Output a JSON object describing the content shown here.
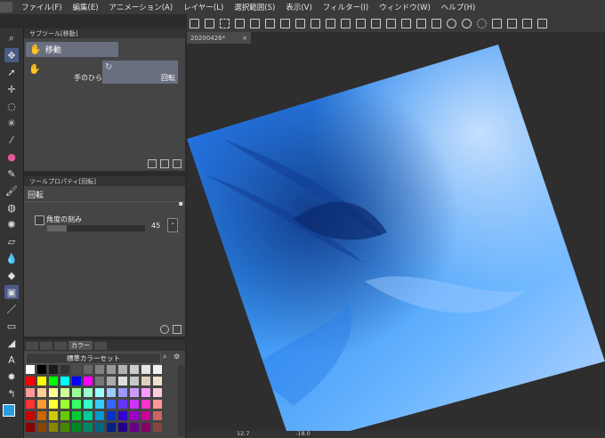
{
  "menu": [
    "ファイル(F)",
    "編集(E)",
    "アニメーション(A)",
    "レイヤー(L)",
    "選択範囲(S)",
    "表示(V)",
    "フィルター(I)",
    "ウィンドウ(W)",
    "ヘルプ(H)"
  ],
  "subtool": {
    "header": "サブツール[移動]",
    "group_label": "移動",
    "item_label": "手のひら",
    "rotate_label": "回転"
  },
  "tool_property": {
    "header": "ツールプロパティ[回転]",
    "title": "回転",
    "angle_label": "角度の刻み",
    "angle_value": "45"
  },
  "color_set": {
    "tab_label": "カラー",
    "set_name": "標準カラーセット"
  },
  "document": {
    "tab_label": "20200426*"
  },
  "status": {
    "zoom": "12.7",
    "angle": "-18.0"
  },
  "colors": {
    "accent": "#4a5c86",
    "main_color": "#2a9bdc"
  },
  "palette": {
    "row1": [
      "#ffffff",
      "#000000",
      "#1a1a1a",
      "#333333",
      "#4d4d4d",
      "#666666",
      "#808080",
      "#999999",
      "#b3b3b3",
      "#cccccc",
      "#e6e6e6",
      "#f2f2f2"
    ],
    "row2": [
      "#ff0000",
      "#ffff00",
      "#00ff00",
      "#00ffff",
      "#0000ff",
      "#ff00ff",
      "#777777",
      "#aaaaaa",
      "#dddddd",
      "#c8c8c8",
      "#e0d0c0",
      "#f0e0d0"
    ],
    "row3": [
      "#ff9999",
      "#ffcc99",
      "#ffff99",
      "#ccff99",
      "#99ff99",
      "#99ffcc",
      "#99ffff",
      "#99ccff",
      "#9999ff",
      "#cc99ff",
      "#ff99ff",
      "#ffccdd"
    ],
    "row4": [
      "#ff3333",
      "#ff9933",
      "#ffff33",
      "#99ff33",
      "#33ff66",
      "#33ffcc",
      "#33ccff",
      "#3366ff",
      "#6633ff",
      "#cc33ff",
      "#ff33cc",
      "#ff9999"
    ],
    "row5": [
      "#cc0000",
      "#cc6600",
      "#cccc00",
      "#66cc00",
      "#00cc33",
      "#00cc99",
      "#0099cc",
      "#0033cc",
      "#3300cc",
      "#9900cc",
      "#cc0099",
      "#cc6666"
    ],
    "row6": [
      "#880000",
      "#884400",
      "#888800",
      "#448800",
      "#008822",
      "#008866",
      "#006688",
      "#002288",
      "#220088",
      "#660088",
      "#880066",
      "#884444"
    ]
  }
}
